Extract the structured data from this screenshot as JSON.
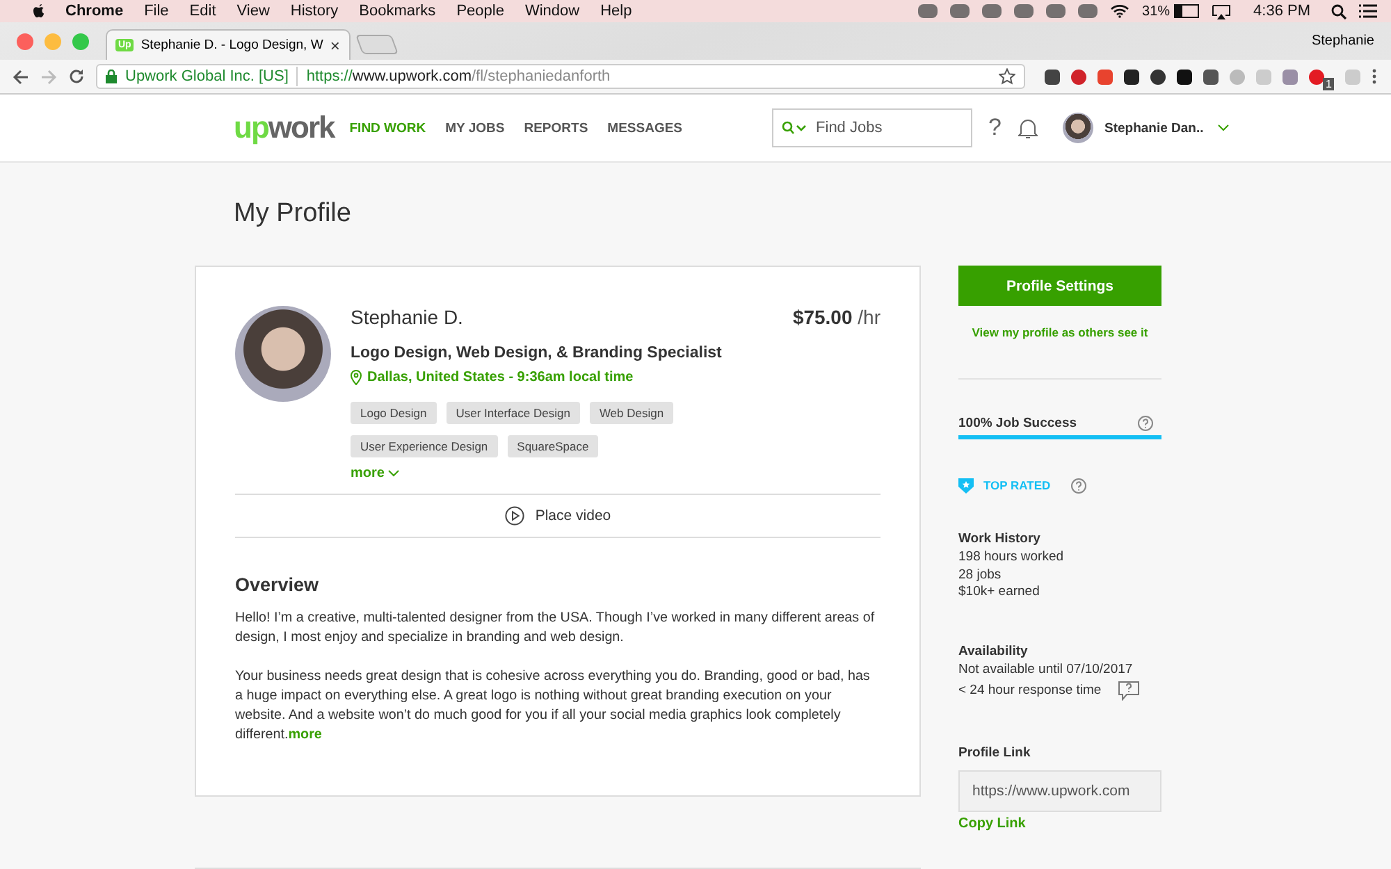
{
  "mac_menu": {
    "app": "Chrome",
    "items": [
      "File",
      "Edit",
      "View",
      "History",
      "Bookmarks",
      "People",
      "Window",
      "Help"
    ],
    "battery": "31%",
    "clock": "4:36 PM"
  },
  "browser": {
    "tab_title": "Stephanie D. - Logo Design, W",
    "tab_close": "×",
    "profile_name": "Stephanie",
    "site_identity": "Upwork Global Inc. [US]",
    "url_scheme": "https://",
    "url_host": "www.upwork.com",
    "url_path": "/fl/stephaniedanforth",
    "tab_badge": "Up",
    "extension_badge": "1"
  },
  "header": {
    "logo": [
      "up",
      "work"
    ],
    "nav": [
      {
        "label": "FIND WORK",
        "selected": true
      },
      {
        "label": "MY JOBS",
        "selected": false
      },
      {
        "label": "REPORTS",
        "selected": false
      },
      {
        "label": "MESSAGES",
        "selected": false
      }
    ],
    "search": {
      "placeholder": "Find Jobs"
    },
    "help": "?",
    "user_name": "Stephanie Dan.."
  },
  "page_title": "My Profile",
  "profile": {
    "name": "Stephanie D.",
    "rate": "$75.00",
    "rate_unit": "/hr",
    "headline": "Logo Design, Web Design, & Branding Specialist",
    "location": "Dallas, United States - 9:36am local time",
    "skills": [
      "Logo Design",
      "User Interface Design",
      "Web Design",
      "User Experience Design",
      "SquareSpace"
    ],
    "more_skills": "more",
    "video": "Place video"
  },
  "overview": {
    "title": "Overview",
    "paragraphs": [
      "Hello! I’m a creative, multi-talented designer from the USA. Though I’ve worked in many different areas of design, I most enjoy and specialize in branding and web design.",
      "Your business needs great design that is cohesive across everything you do. Branding, good or bad, has a huge impact on everything else. A great logo is nothing without great branding execution on your website. And a website won’t do much good for you if all your social media graphics look completely different."
    ],
    "more": "more"
  },
  "sidebar": {
    "settings_button": "Profile Settings",
    "view_as_others": "View my profile as others see it",
    "job_success": {
      "label": "100% Job Success",
      "level": 1.0
    },
    "badge": "TOP RATED",
    "work_history": {
      "title": "Work History",
      "lines": [
        "198 hours worked",
        "28 jobs",
        "$10k+ earned"
      ]
    },
    "availability": {
      "title": "Availability",
      "status": "Not available until 07/10/2017",
      "response": "< 24 hour response time"
    },
    "profile_link": {
      "title": "Profile Link",
      "value": "https://www.upwork.com",
      "copy": "Copy Link"
    }
  }
}
